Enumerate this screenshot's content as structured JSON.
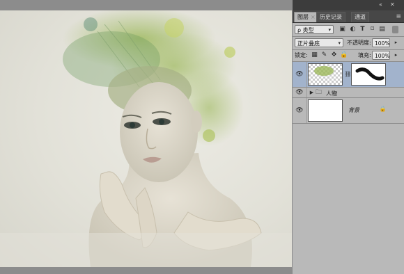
{
  "panel": {
    "tabs": [
      {
        "label": "图层",
        "active": true
      },
      {
        "label": "历史记录",
        "active": false
      },
      {
        "label": "通道",
        "active": false
      }
    ],
    "filter": {
      "label": "ρ 类型"
    },
    "filter_icons": [
      "image-filter-icon",
      "adjustment-filter-icon",
      "type-filter-icon",
      "shape-filter-icon",
      "smart-object-filter-icon"
    ],
    "blend_mode": "正片叠底",
    "opacity_label": "不透明度:",
    "opacity_value": "100%",
    "lock_label": "锁定:",
    "fill_label": "填充:",
    "fill_value": "100%",
    "layers": [
      {
        "name": "",
        "type": "masked-layer",
        "selected": true
      },
      {
        "name": "人物",
        "type": "group"
      },
      {
        "name": "背景",
        "type": "background",
        "locked": true
      }
    ]
  },
  "colors": {
    "panel_bg": "#b9b9b9",
    "selected_layer": "#a2b3cc",
    "dark_chrome": "#535353"
  }
}
